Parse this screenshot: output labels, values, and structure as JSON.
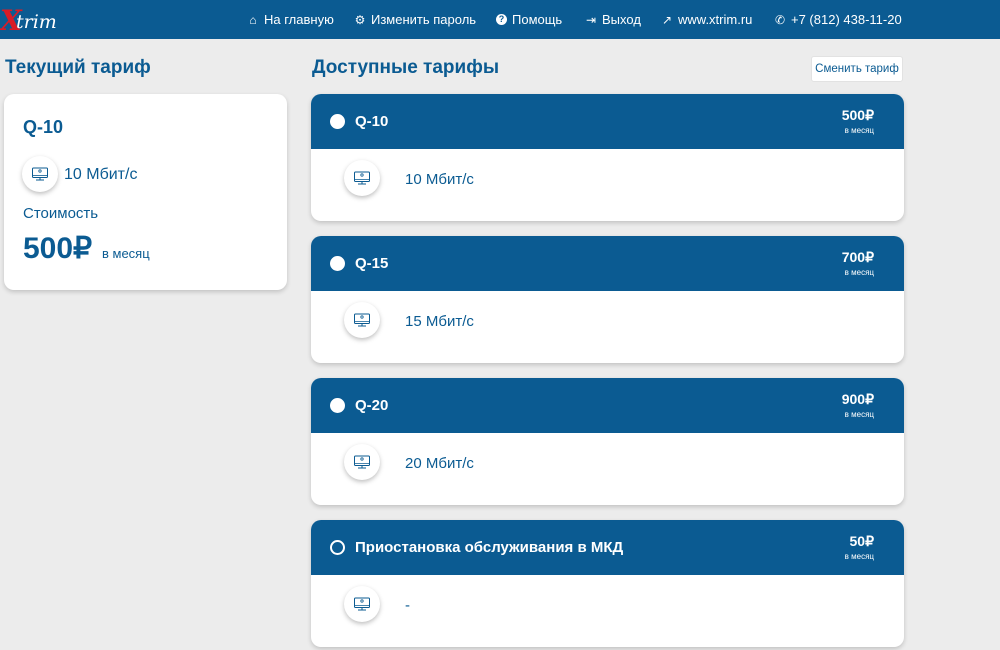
{
  "brand": {
    "logo_x": "X",
    "logo_rest": "trim"
  },
  "nav": [
    {
      "icon": "home-icon",
      "glyph": "⌂",
      "label": "На главную"
    },
    {
      "icon": "gear-icon",
      "glyph": "⚙",
      "label": "Изменить пароль"
    },
    {
      "icon": "help-icon",
      "glyph": "?",
      "label": "Помощь"
    },
    {
      "icon": "logout-icon",
      "glyph": "⇥",
      "label": "Выход"
    },
    {
      "icon": "external-link-icon",
      "glyph": "↗",
      "label": "www.xtrim.ru"
    },
    {
      "icon": "phone-icon",
      "glyph": "✆",
      "label": "+7 (812) 438-11-20"
    }
  ],
  "current": {
    "heading": "Текущий тариф",
    "name": "Q-10",
    "speed": "10 Мбит/с",
    "cost_label": "Стоимость",
    "price": "500₽",
    "per": "в месяц"
  },
  "available": {
    "heading": "Доступные тарифы",
    "change_button": "Сменить тариф",
    "tariffs": [
      {
        "name": "Q-10",
        "price": "500₽",
        "per": "в месяц",
        "speed": "10 Мбит/с",
        "radio": "filled"
      },
      {
        "name": "Q-15",
        "price": "700₽",
        "per": "в месяц",
        "speed": "15 Мбит/с",
        "radio": "filled"
      },
      {
        "name": "Q-20",
        "price": "900₽",
        "per": "в месяц",
        "speed": "20 Мбит/с",
        "radio": "filled"
      },
      {
        "name": "Приостановка обслуживания в МКД",
        "price": "50₽",
        "per": "в месяц",
        "speed": "-",
        "radio": "empty"
      }
    ]
  },
  "colors": {
    "primary": "#0b5b92",
    "logo_red": "#d91c26",
    "background": "#ececec"
  }
}
